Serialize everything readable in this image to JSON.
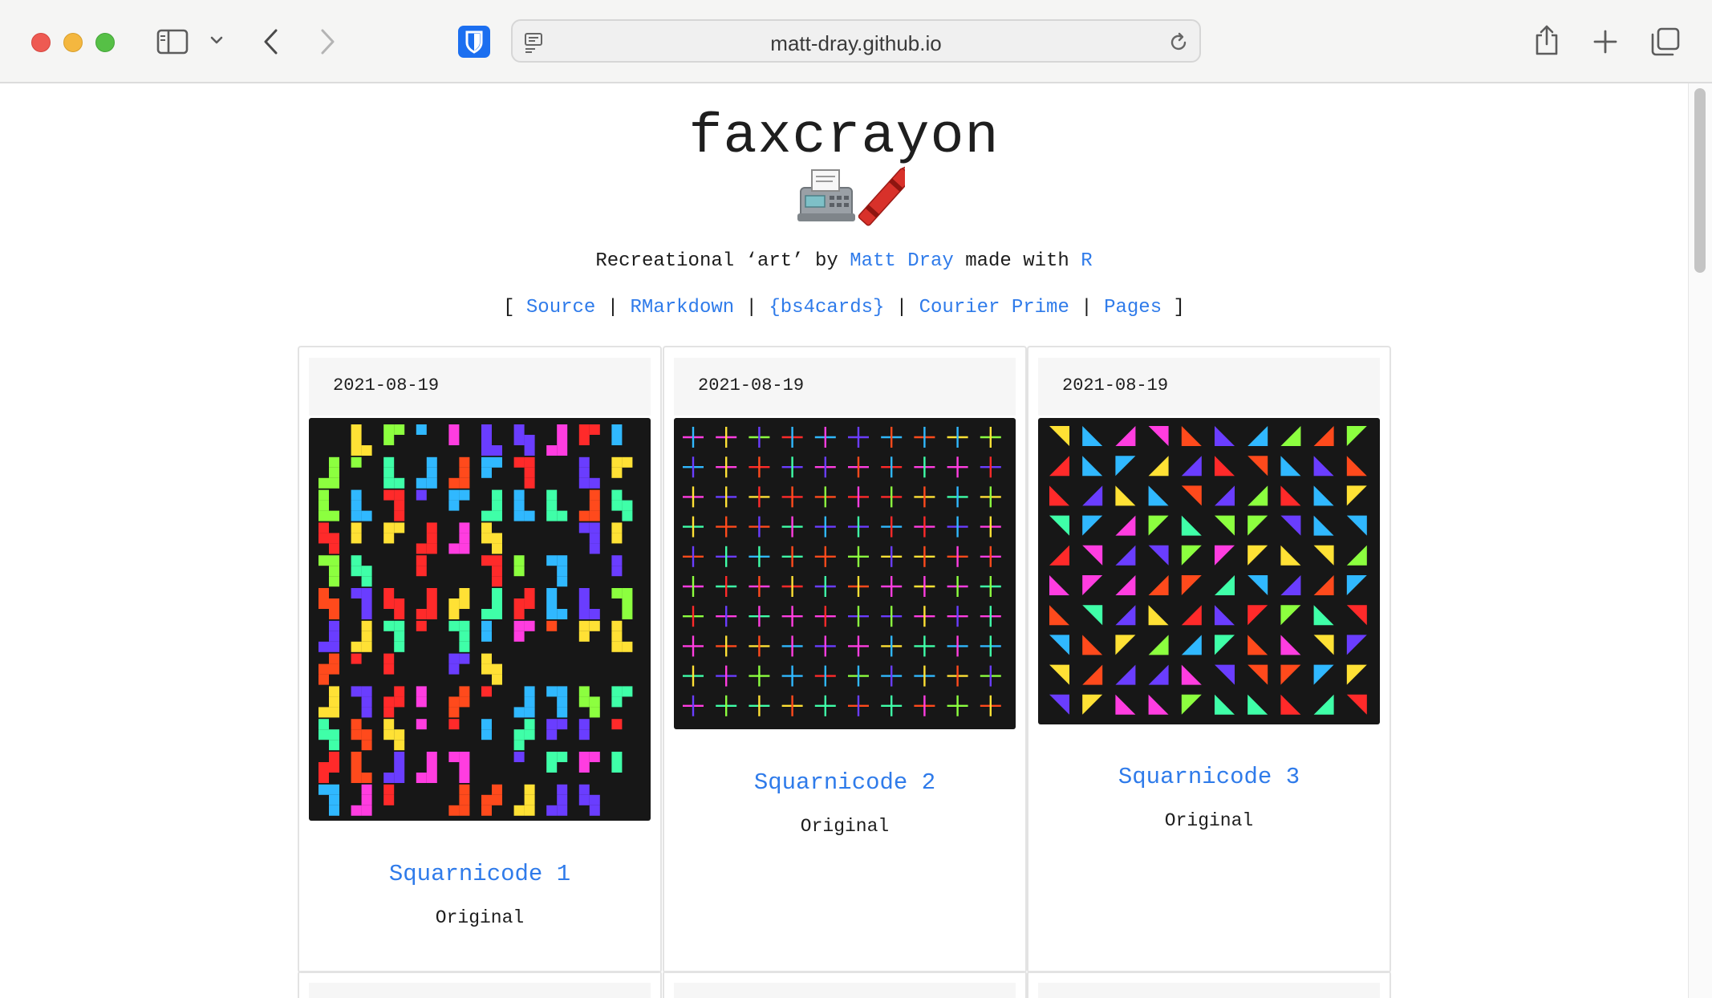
{
  "browser": {
    "url": "matt-dray.github.io"
  },
  "page": {
    "title": "faxcrayon",
    "subtitle": {
      "before": "Recreational ‘art’ by ",
      "author_link": "Matt Dray",
      "middle": " made with ",
      "lang_link": "R"
    },
    "nav": {
      "open": "[ ",
      "sep": " | ",
      "close": " ]",
      "links": [
        "Source",
        "RMarkdown",
        "{bs4cards}",
        "Courier Prime",
        "Pages"
      ]
    }
  },
  "cards": [
    {
      "date": "2021-08-19",
      "title": "Squarnicode 1",
      "subtitle": "Original",
      "artwork": "tetromino-shapes"
    },
    {
      "date": "2021-08-19",
      "title": "Squarnicode 2",
      "subtitle": "Original",
      "artwork": "plus-signs"
    },
    {
      "date": "2021-08-19",
      "title": "Squarnicode 3",
      "subtitle": "Original",
      "artwork": "triangles"
    }
  ],
  "art_palette": [
    "#ff4a1c",
    "#ffe135",
    "#8cff3f",
    "#3fffa8",
    "#30b8ff",
    "#6a3dff",
    "#ff3de0",
    "#ff2a2a"
  ]
}
